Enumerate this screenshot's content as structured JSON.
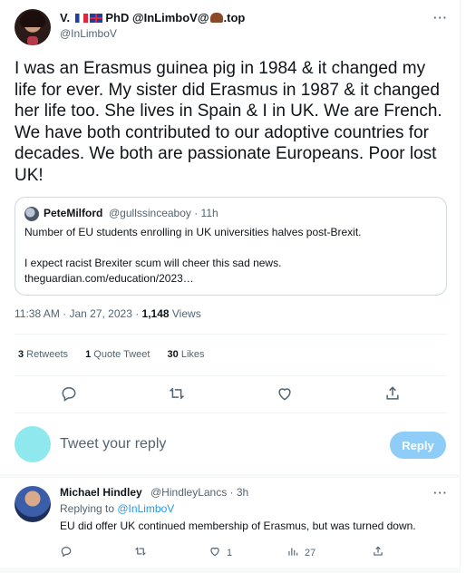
{
  "main_tweet": {
    "author": {
      "name_prefix": "V.",
      "name_suffix": "PhD @InLimboV@",
      "name_tail": ".top",
      "flags": [
        "flag-fr-icon",
        "flag-gb-icon"
      ],
      "emoji": "mammoth-icon",
      "handle": "@InLimboV"
    },
    "text": "I was an Erasmus guinea pig in 1984 & it changed my life for ever. My sister did Erasmus in 1987 & it changed her life too. She lives in Spain & I in UK. We are French. We have both contributed to our adoptive countries for decades. We both are passionate Europeans. Poor lost UK!",
    "quote": {
      "name": "PeteMilford",
      "handle_time": "@gullssinceaboy · 11h",
      "line1": "Number of EU students enrolling in UK universities halves post-Brexit.",
      "line2": "I expect racist Brexiter scum will cheer this sad news.",
      "line3": "theguardian.com/education/2023…"
    },
    "timestamp": "11:38 AM · Jan 27, 2023 · ",
    "views_count": "1,148",
    "views_label": " Views",
    "stats": {
      "retweets_count": "3",
      "retweets_label": " Retweets",
      "quotes_count": "1",
      "quotes_label": " Quote Tweet",
      "likes_count": "30",
      "likes_label": " Likes"
    },
    "actions": [
      "reply-icon",
      "retweet-icon",
      "like-icon",
      "share-icon"
    ]
  },
  "compose": {
    "placeholder": "Tweet your reply",
    "button": "Reply"
  },
  "reply": {
    "name": "Michael Hindley",
    "handle_time": "@HindleyLancs · 3h",
    "replying_prefix": "Replying to ",
    "replying_handle": "@InLimboV",
    "text": "EU did offer UK continued membership of Erasmus, but was turned down.",
    "like_count": "1",
    "views_count": "27"
  },
  "colors": {
    "accent": "#1d9bf0",
    "reply_button": "#8ecdf8",
    "muted": "#536471",
    "text": "#0f1419"
  }
}
